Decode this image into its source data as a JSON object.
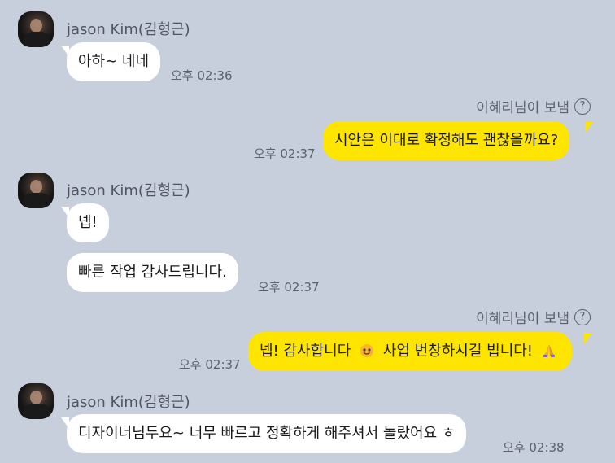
{
  "messages": [
    {
      "sender": "jason Kim(김형근)",
      "text": "아하~ 네네",
      "time": "오후 02:36"
    },
    {
      "note": "이혜리님이 보냄",
      "help": "?",
      "text": "시안은 이대로 확정해도 괜찮을까요?",
      "time": "오후 02:37"
    },
    {
      "sender": "jason Kim(김형근)",
      "text": "넵!",
      "text2": "빠른 작업 감사드립니다.",
      "time": "오후 02:37"
    },
    {
      "note": "이혜리님이 보냄",
      "help": "?",
      "text_a": "넵! 감사합니다",
      "text_b": "사업 번창하시길 빕니다!",
      "time": "오후 02:37",
      "emojis": [
        "smiling-face-emoji",
        "praying-hands-emoji"
      ]
    },
    {
      "sender": "jason Kim(김형근)",
      "text": "디자이너님두요~ 너무 빠르고 정확하게 해주셔서 놀랐어요 ㅎ",
      "time": "오후 02:38"
    }
  ],
  "colors": {
    "background": "#c7cedc",
    "incoming": "#ffffff",
    "outgoing": "#fee500"
  }
}
